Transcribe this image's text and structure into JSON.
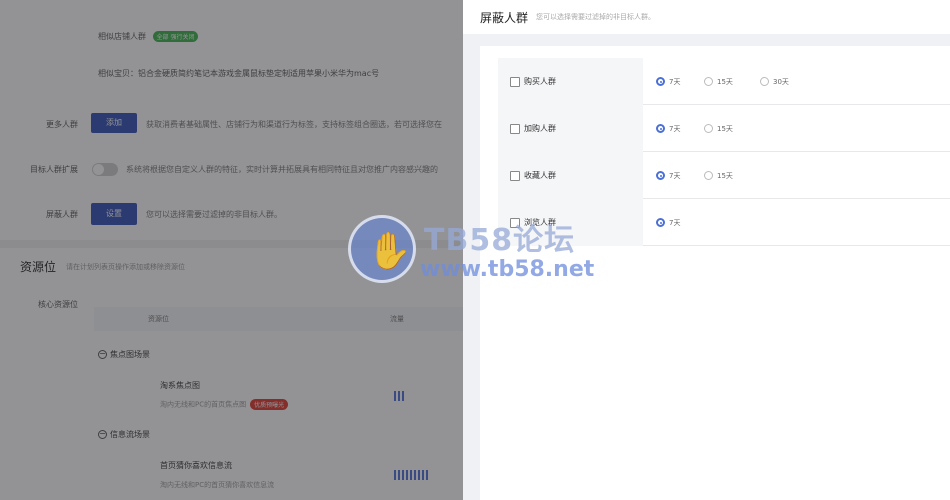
{
  "background": {
    "similar_store": {
      "label": "相似店铺人群",
      "tag": "全部 强行关闭"
    },
    "similar_item": {
      "label": "相似宝贝：",
      "text": "铝合金硬质简约笔记本游戏金属鼠标垫定制适用苹果小米华为mac号"
    },
    "more_crowd": {
      "label": "更多人群",
      "button": "添加",
      "desc": "获取消费者基础属性、店铺行为和渠道行为标签，支持标签组合圈选，若可选择您在"
    },
    "target_expand": {
      "label": "目标人群扩展",
      "desc": "系统将根据您自定义人群的特征，实时计算并拓展具有相同特征且对您推广内容感兴趣的"
    },
    "block_crowd": {
      "label": "屏蔽人群",
      "button": "设置",
      "desc": "您可以选择需要过滤掉的非目标人群。"
    },
    "resource": {
      "title": "资源位",
      "subtitle": "请在计划列表页操作添加或移除资源位",
      "core_label": "核心资源位",
      "col_resource": "资源位",
      "col_traffic": "流量",
      "groups": [
        {
          "name": "焦点图场景",
          "items": [
            {
              "title": "淘系焦点图",
              "desc": "淘内无线和PC的首页焦点图",
              "tag": "优质预曝光",
              "bars": 3
            }
          ]
        },
        {
          "name": "信息流场景",
          "items": [
            {
              "title": "首页猜你喜欢信息流",
              "desc": "淘内无线和PC的首页猜你喜欢信息流",
              "tag": "",
              "bars": 9
            }
          ]
        }
      ]
    }
  },
  "drawer": {
    "title": "屏蔽人群",
    "subtitle": "您可以选择需要过滤掉的非目标人群。",
    "rows": [
      {
        "label": "购买人群",
        "checked": false,
        "options": [
          {
            "label": "7天",
            "selected": true
          },
          {
            "label": "15天",
            "selected": false
          },
          {
            "label": "30天",
            "selected": false
          }
        ]
      },
      {
        "label": "加购人群",
        "checked": false,
        "options": [
          {
            "label": "7天",
            "selected": true
          },
          {
            "label": "15天",
            "selected": false
          }
        ]
      },
      {
        "label": "收藏人群",
        "checked": false,
        "options": [
          {
            "label": "7天",
            "selected": true
          },
          {
            "label": "15天",
            "selected": false
          }
        ]
      },
      {
        "label": "浏览人群",
        "checked": false,
        "options": [
          {
            "label": "7天",
            "selected": true
          }
        ]
      }
    ]
  },
  "watermark": {
    "line1": "TB58论坛",
    "line2": "www.tb58.net"
  },
  "colors": {
    "accent": "#4a6fd8",
    "button_blue": "#2f4db5",
    "tag_green": "#3bb34a",
    "tag_red": "#e0352b"
  }
}
